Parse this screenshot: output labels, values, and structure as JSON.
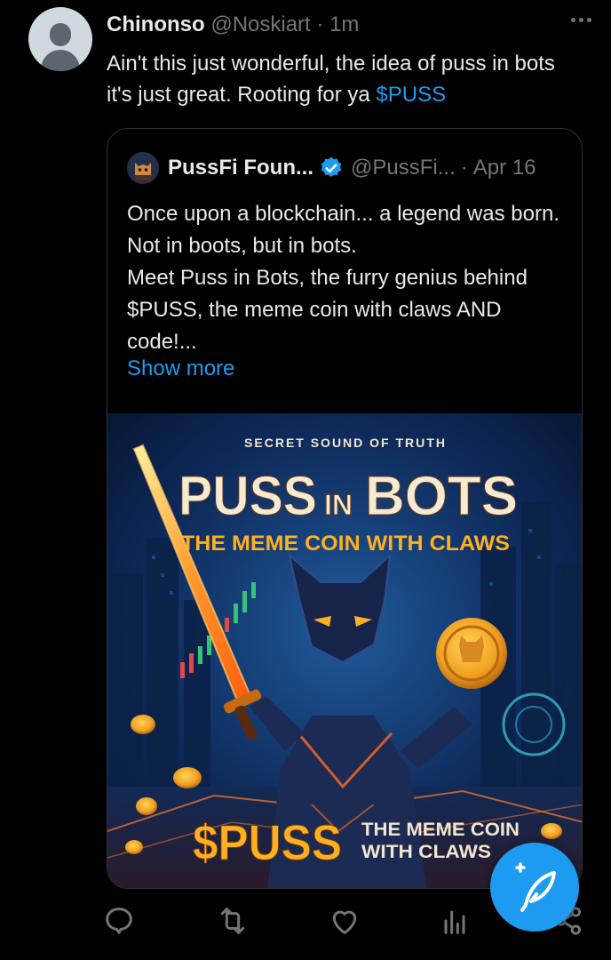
{
  "tweet": {
    "author_name": "Chinonso",
    "author_handle": "@Noskiart",
    "separator": "·",
    "time": "1m",
    "text": "Ain't this just wonderful, the idea of puss in bots it's just great. Rooting for ya ",
    "cashtag": "$PUSS"
  },
  "quote": {
    "author_name": "PussFi Foun...",
    "author_handle": "@PussFi...",
    "separator": "·",
    "date": "Apr 16",
    "text": "Once upon a blockchain... a legend was born. Not in boots, but in bots.\nMeet Puss in Bots,  the furry genius behind $PUSS, the meme coin with claws AND code!...",
    "show_more": "Show more"
  },
  "media": {
    "kicker": "SECRET SOUND OF TRUTH",
    "title_1": "PUSS",
    "title_in": "IN",
    "title_2": "BOTS",
    "subtitle": "THE MEME COIN WITH CLAWS",
    "bottom_ticker": "$PUSS",
    "bottom_tag_1": "THE MEME COIN",
    "bottom_tag_2": "WITH CLAWS"
  },
  "actions": [
    "reply-icon",
    "retweet-icon",
    "like-icon",
    "views-icon",
    "share-icon"
  ],
  "colors": {
    "accent": "#1d9bf0",
    "muted": "#71767b",
    "text": "#e7e9ea",
    "background": "#000000"
  }
}
